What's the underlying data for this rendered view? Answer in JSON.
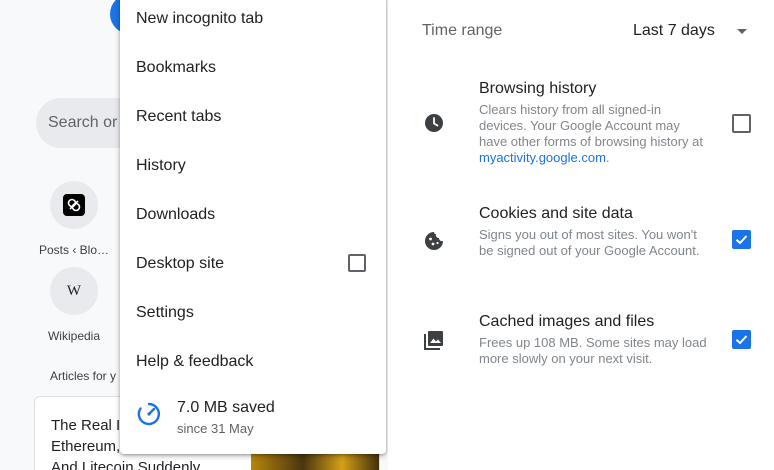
{
  "new_tab_page": {
    "search_placeholder": "Search or",
    "shortcuts": [
      {
        "label": "Posts ‹ Blo…",
        "icon": "link-chain-icon"
      },
      {
        "label": "Wikipedia",
        "icon": "wikipedia-w-icon",
        "glyph": "W"
      }
    ],
    "articles_label": "Articles for y",
    "article": {
      "line1": "The Real I",
      "line2": "Ethereum,",
      "line3": "And Litecoin Suddenly …"
    }
  },
  "menu": {
    "items": [
      {
        "label": "New incognito tab"
      },
      {
        "label": "Bookmarks"
      },
      {
        "label": "Recent tabs"
      },
      {
        "label": "History"
      },
      {
        "label": "Downloads"
      },
      {
        "label": "Desktop site",
        "checked": false
      },
      {
        "label": "Settings"
      },
      {
        "label": "Help & feedback"
      }
    ],
    "data_saved": {
      "amount": "7.0 MB saved",
      "since": "since 31 May",
      "icon": "data-saver-gauge-icon"
    }
  },
  "clear_data": {
    "time_range_label": "Time range",
    "time_range_value": "Last 7 days",
    "items": [
      {
        "title": "Browsing history",
        "desc": "Clears history from all signed-in devices. Your Google Account may have other forms of browsing history at ",
        "link": "myactivity.google.com",
        "desc_end": ".",
        "checked": false,
        "icon": "clock-icon"
      },
      {
        "title": "Cookies and site data",
        "desc": "Signs you out of most sites. You won't be signed out of your Google Account.",
        "checked": true,
        "icon": "cookie-icon"
      },
      {
        "title": "Cached images and files",
        "desc": "Frees up 108 MB. Some sites may load more slowly on your next visit.",
        "checked": true,
        "icon": "image-icon"
      }
    ],
    "accent_color": "#1a73e8"
  }
}
